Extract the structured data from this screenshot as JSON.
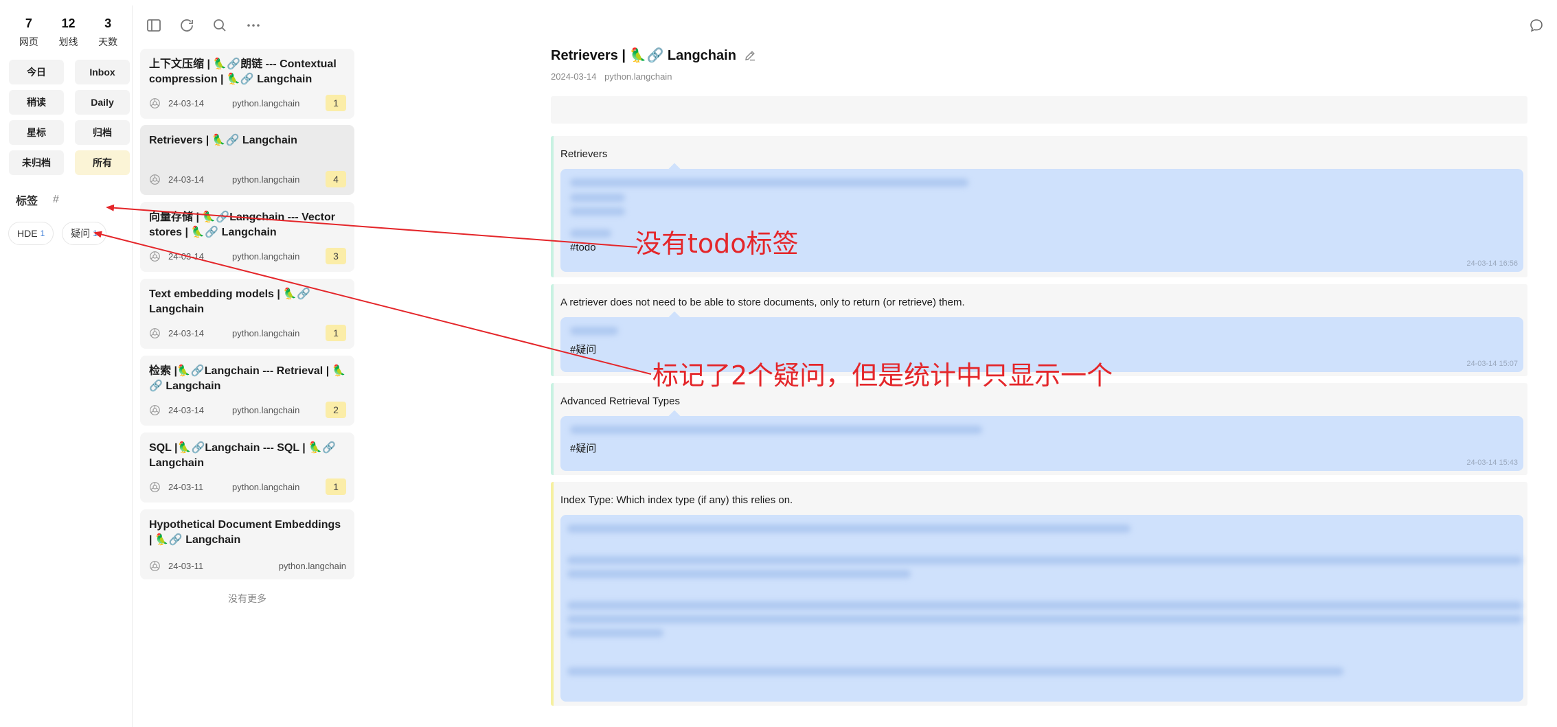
{
  "stats": [
    {
      "num": "7",
      "label": "网页"
    },
    {
      "num": "12",
      "label": "划线"
    },
    {
      "num": "3",
      "label": "天数"
    }
  ],
  "filters": [
    {
      "label": "今日",
      "active": false
    },
    {
      "label": "Inbox",
      "active": false
    },
    {
      "label": "稍读",
      "active": false
    },
    {
      "label": "Daily",
      "active": false
    },
    {
      "label": "星标",
      "active": false
    },
    {
      "label": "归档",
      "active": false
    },
    {
      "label": "未归档",
      "active": false
    },
    {
      "label": "所有",
      "active": true
    }
  ],
  "tags_heading": "标签",
  "tags_hash": "#",
  "tags": [
    {
      "name": "HDE",
      "count": "1"
    },
    {
      "name": "疑问",
      "count": "1"
    }
  ],
  "toolbar": [
    "sidebar-toggle-icon",
    "refresh-icon",
    "search-icon",
    "more-icon"
  ],
  "articles": [
    {
      "title": "上下文压缩 | 🦜🔗朗链 --- Contextual compression | 🦜🔗 Langchain",
      "date": "24-03-14",
      "domain": "python.langchain",
      "count": "1",
      "selected": false
    },
    {
      "title": "Retrievers | 🦜🔗 Langchain",
      "date": "24-03-14",
      "domain": "python.langchain",
      "count": "4",
      "selected": true
    },
    {
      "title": "向量存储 | 🦜🔗Langchain --- Vector stores | 🦜🔗 Langchain",
      "date": "24-03-14",
      "domain": "python.langchain",
      "count": "3",
      "selected": false
    },
    {
      "title": "Text embedding models | 🦜🔗 Langchain",
      "date": "24-03-14",
      "domain": "python.langchain",
      "count": "1",
      "selected": false
    },
    {
      "title": "检索 |🦜🔗Langchain --- Retrieval | 🦜🔗 Langchain",
      "date": "24-03-14",
      "domain": "python.langchain",
      "count": "2",
      "selected": false
    },
    {
      "title": "SQL |🦜🔗Langchain --- SQL | 🦜🔗 Langchain",
      "date": "24-03-11",
      "domain": "python.langchain",
      "count": "1",
      "selected": false
    },
    {
      "title": "Hypothetical Document Embeddings | 🦜🔗 Langchain",
      "date": "24-03-11",
      "domain": "python.langchain",
      "count": "",
      "selected": false
    }
  ],
  "no_more": "没有更多",
  "detail": {
    "title": "Retrievers | 🦜🔗 Langchain",
    "date": "2024-03-14",
    "domain": "python.langchain",
    "highlights": [
      {
        "quote": "Retrievers",
        "tag": "#todo",
        "timestamp": "24-03-14 16:56"
      },
      {
        "quote": "A retriever does not need to be able to store documents, only to return (or retrieve) them.",
        "tag": "#疑问",
        "timestamp": "24-03-14 15:07"
      },
      {
        "quote": "Advanced Retrieval Types",
        "tag": "#疑问",
        "timestamp": "24-03-14 15:43"
      },
      {
        "quote": "Index Type: Which index type (if any) this relies on.",
        "tag": "",
        "timestamp": ""
      }
    ]
  },
  "annotations": {
    "no_todo": "没有todo标签",
    "two_questions": "标记了2个疑问，但是统计中只显示一个"
  },
  "colors": {
    "annotation": "#e4262a",
    "note_bg": "#cfe1fc",
    "badge_bg": "#fbeda8",
    "active_filter": "#fbf4d6"
  }
}
